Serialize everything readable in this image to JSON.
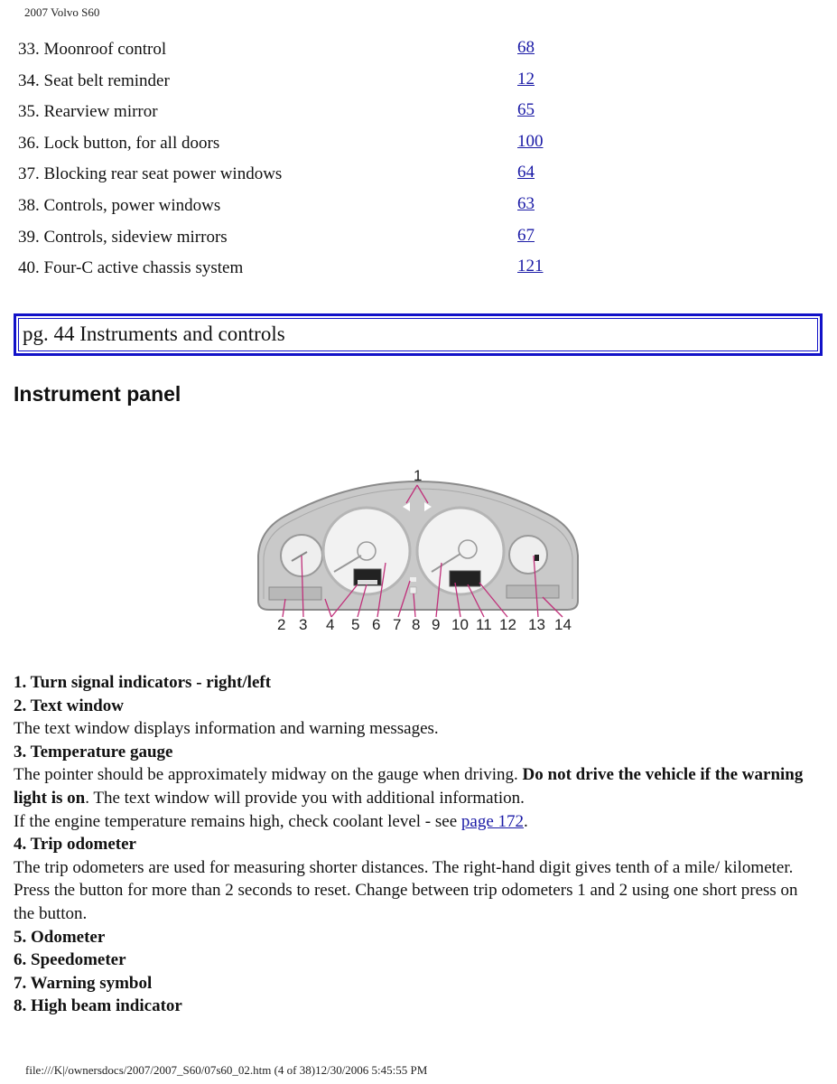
{
  "header": {
    "title": "2007 Volvo S60"
  },
  "toc": [
    {
      "label": "33. Moonroof control",
      "page": "68"
    },
    {
      "label": "34. Seat belt reminder",
      "page": "12"
    },
    {
      "label": "35. Rearview mirror",
      "page": "65"
    },
    {
      "label": "36. Lock button, for all doors",
      "page": "100"
    },
    {
      "label": "37. Blocking rear seat power windows",
      "page": "64"
    },
    {
      "label": "38. Controls, power windows",
      "page": "63"
    },
    {
      "label": "39. Controls, sideview mirrors",
      "page": "67"
    },
    {
      "label": "40. Four-C active chassis system",
      "page": "121"
    }
  ],
  "section": {
    "box_title": "pg. 44 Instruments and controls",
    "heading": "Instrument panel"
  },
  "diagram": {
    "callout_top": "1",
    "callouts_bottom": [
      "2",
      "3",
      "4",
      "5",
      "6",
      "7",
      "8",
      "9",
      "10",
      "11",
      "12",
      "13",
      "14"
    ],
    "colors": {
      "panel": "#c9c9c9",
      "panel_edge": "#8a8a8a",
      "gauge_face": "#f2f2f2",
      "pointer_line": "#c0307a"
    }
  },
  "items": {
    "i1_title": "1. Turn signal indicators - right/left",
    "i2_title": "2. Text window",
    "i2_text": "The text window displays information and warning messages.",
    "i3_title": "3. Temperature gauge",
    "i3_text_a": "The pointer should be approximately midway on the gauge when driving. ",
    "i3_text_bold": "Do not drive the vehicle if the warning light is on",
    "i3_text_b": ". The text window will provide you with additional information.",
    "i3_text_c": "If the engine temperature remains high, check coolant level - see ",
    "i3_link": "page 172",
    "i3_text_d": ".",
    "i4_title": "4. Trip odometer",
    "i4_text": "The trip odometers are used for measuring shorter distances. The right-hand digit gives tenth of a mile/ kilometer. Press the button for more than 2 seconds to reset. Change between trip odometers 1 and 2 using one short press on the button.",
    "i5_title": "5. Odometer",
    "i6_title": "6. Speedometer",
    "i7_title": "7. Warning symbol",
    "i8_title": "8. High beam indicator"
  },
  "footer": {
    "text": "file:///K|/ownersdocs/2007/2007_S60/07s60_02.htm (4 of 38)12/30/2006 5:45:55 PM"
  }
}
